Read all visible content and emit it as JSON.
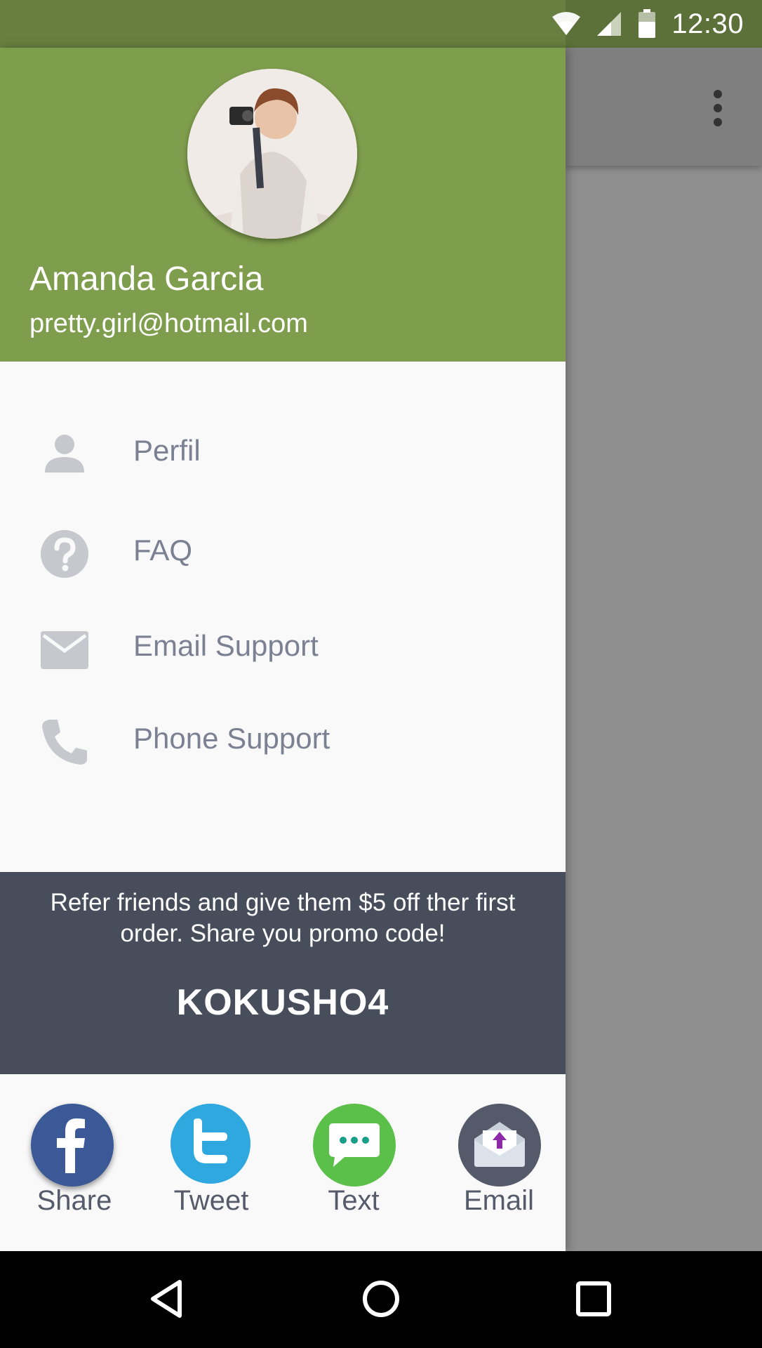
{
  "status_bar": {
    "time": "12:30",
    "icons": [
      "wifi-icon",
      "signal-icon",
      "battery-icon"
    ]
  },
  "header": {
    "user_name": "Amanda Garcia",
    "user_email": "pretty.girl@hotmail.com"
  },
  "menu": {
    "items": [
      {
        "label": "Perfil",
        "icon": "person-icon"
      },
      {
        "label": "FAQ",
        "icon": "help-icon"
      },
      {
        "label": "Email Support",
        "icon": "mail-icon"
      },
      {
        "label": "Phone Support",
        "icon": "phone-icon"
      }
    ]
  },
  "promo": {
    "text": "Refer friends and give them $5 off ther first order. Share you promo code!",
    "code": "KOKUSHO4"
  },
  "share": {
    "items": [
      {
        "label": "Share",
        "icon": "facebook-icon",
        "color": "#3b5897"
      },
      {
        "label": "Tweet",
        "icon": "twitter-icon",
        "color": "#2fa8e0"
      },
      {
        "label": "Text",
        "icon": "message-icon",
        "color": "#5ac04a"
      },
      {
        "label": "Email",
        "icon": "email-envelope-icon",
        "color": "#545a6a"
      }
    ]
  },
  "colors": {
    "header_green": "#7f9e4d",
    "status_bar_green": "#677f40",
    "promo_bg": "#484d5b",
    "menu_text": "#7b8193"
  },
  "nav_bar": {
    "buttons": [
      "back-icon",
      "home-icon",
      "recents-icon"
    ]
  }
}
